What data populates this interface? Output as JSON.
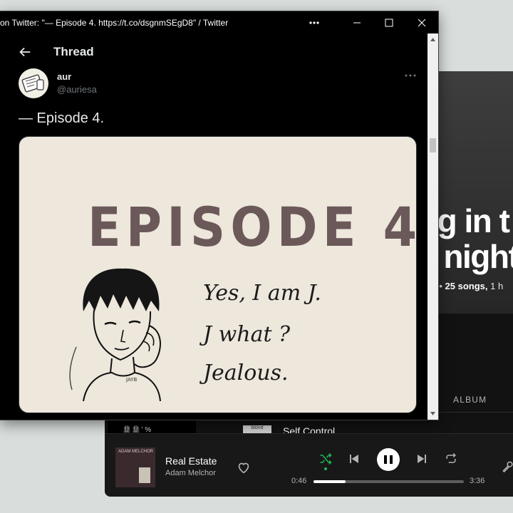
{
  "twitter": {
    "window_title": "on Twitter: \"— Episode 4. https://t.co/dsgnmSEgD8\" / Twitter",
    "header_title": "Thread",
    "author": {
      "name": "aur",
      "handle": "@auriesa"
    },
    "tweet_text": "— Episode 4.",
    "media": {
      "heading": "EPISODE 4",
      "lines": [
        "Yes, I am J.",
        "J what ?",
        "Jealous."
      ],
      "signature": "JAYB"
    }
  },
  "spotify": {
    "playlist_title_line1": "ng in t",
    "playlist_title_line2": "e night",
    "playlist_meta_prefix": "es • ",
    "playlist_meta_songs": "25 songs,",
    "playlist_meta_suffix": "1 h",
    "column_album": "ALBUM",
    "row_thumb_text": "韭 韭 ' %",
    "row_art_text": "blond",
    "row_song_partial": "Self Control",
    "player": {
      "song": "Real Estate",
      "artist": "Adam Melchor",
      "cover_text": "ADAM MELCHOR",
      "elapsed": "0:46",
      "duration": "3:36",
      "progress": 0.213
    }
  },
  "colors": {
    "spotify_green": "#1db954",
    "twitter_bg": "#000000",
    "spotify_bg": "#121212"
  }
}
